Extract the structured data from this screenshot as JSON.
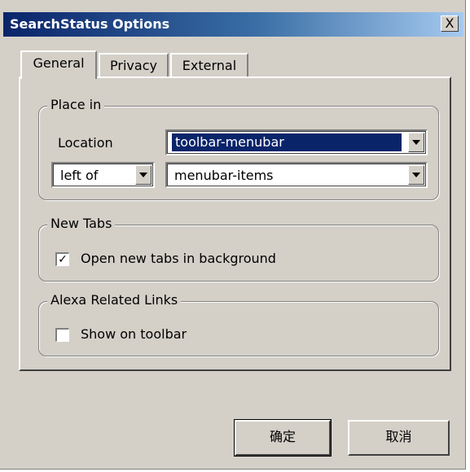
{
  "window": {
    "title": "SearchStatus Options",
    "close_label": "X"
  },
  "tabs": [
    {
      "label": "General",
      "active": true
    },
    {
      "label": "Privacy",
      "active": false
    },
    {
      "label": "External",
      "active": false
    }
  ],
  "place_in": {
    "legend": "Place in",
    "location_label": "Location",
    "location_value": "toolbar-menubar",
    "position_value": "left of",
    "anchor_value": "menubar-items"
  },
  "new_tabs": {
    "legend": "New Tabs",
    "open_in_background_label": "Open new tabs in background",
    "open_in_background_checked": true,
    "check_mark": "✓"
  },
  "alexa": {
    "legend": "Alexa Related Links",
    "show_on_toolbar_label": "Show on toolbar",
    "show_on_toolbar_checked": false
  },
  "buttons": {
    "ok_label": "确定",
    "cancel_label": "取消"
  }
}
